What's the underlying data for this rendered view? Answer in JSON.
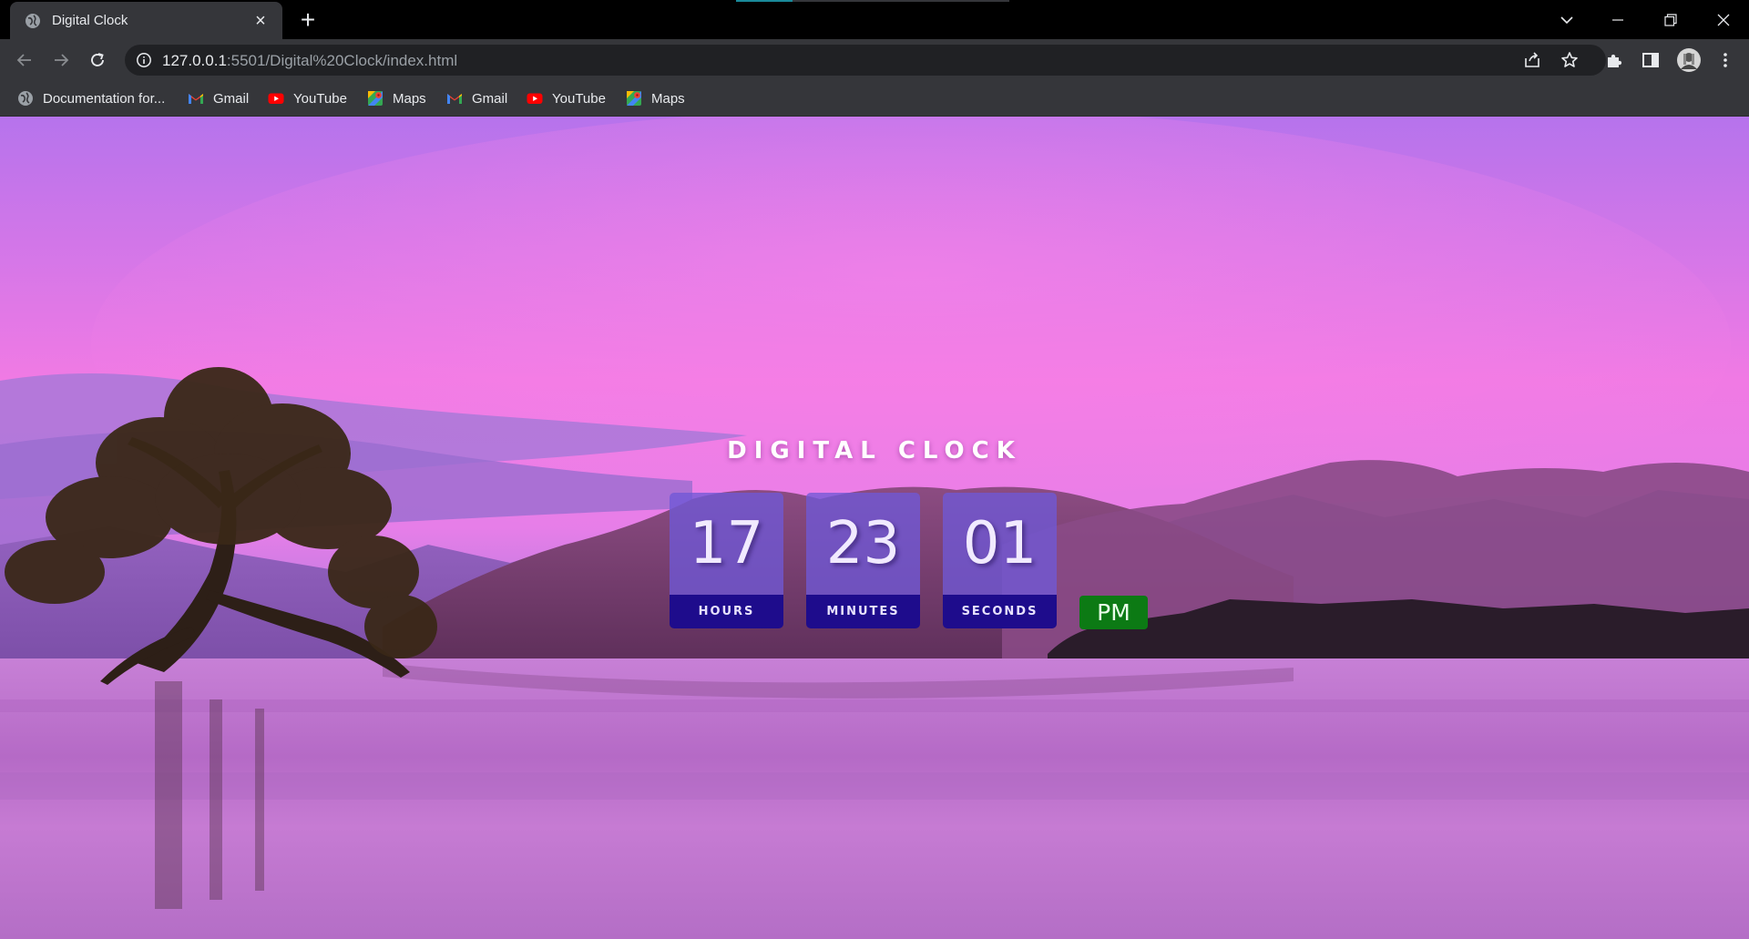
{
  "browser": {
    "tab": {
      "title": "Digital Clock",
      "close_glyph": "×",
      "icon": "globe-icon"
    },
    "new_tab_glyph": "+",
    "address": {
      "host": "127.0.0.1",
      "path": ":5501/Digital%20Clock/index.html"
    },
    "bookmarks": [
      {
        "label": "Documentation for...",
        "icon": "globe-icon"
      },
      {
        "label": "Gmail",
        "icon": "gmail-icon"
      },
      {
        "label": "YouTube",
        "icon": "youtube-icon"
      },
      {
        "label": "Maps",
        "icon": "maps-icon"
      },
      {
        "label": "Gmail",
        "icon": "gmail-icon"
      },
      {
        "label": "YouTube",
        "icon": "youtube-icon"
      },
      {
        "label": "Maps",
        "icon": "maps-icon"
      }
    ]
  },
  "clock": {
    "title": "DIGITAL CLOCK",
    "hours": {
      "value": "17",
      "label": "HOURS"
    },
    "minutes": {
      "value": "23",
      "label": "MINUTES"
    },
    "seconds": {
      "value": "01",
      "label": "SECONDS"
    },
    "period": "PM"
  },
  "colors": {
    "digit_box": "#7058d6",
    "label_box": "#1e0c8c",
    "period_box": "#0c7a14",
    "sky": "#e07ae8"
  }
}
